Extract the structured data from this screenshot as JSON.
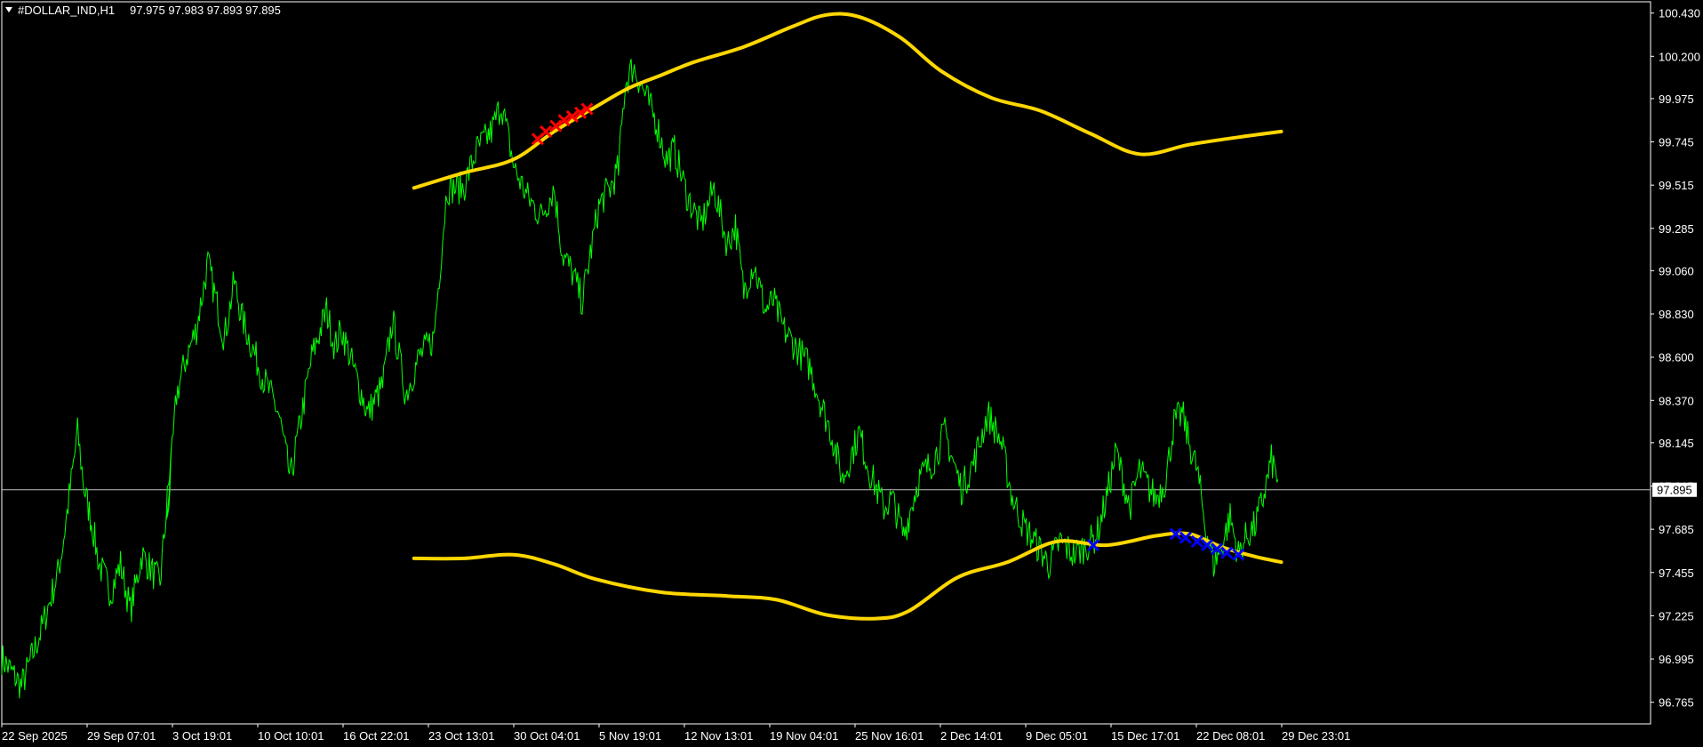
{
  "header": {
    "symbol": "#DOLLAR_IND,H1",
    "ohlc": "97.975 97.983 97.893 97.895"
  },
  "colors": {
    "background": "#000000",
    "frame": "#ffffff",
    "price": "#00ff00",
    "band": "#ffd700",
    "sell_marker": "#ff0000",
    "buy_marker": "#0000ff",
    "bid_line": "#c0c0c0"
  },
  "chart_data": {
    "type": "line",
    "title": "",
    "xlabel": "",
    "ylabel": "",
    "ylim": [
      96.65,
      100.49
    ],
    "yticks": [
      "100.430",
      "100.200",
      "99.975",
      "99.745",
      "99.515",
      "99.285",
      "99.060",
      "98.830",
      "98.600",
      "98.370",
      "98.145",
      "97.915",
      "97.685",
      "97.455",
      "97.225",
      "96.995",
      "96.765"
    ],
    "xticks": [
      "22 Sep 2025",
      "29 Sep 07:01",
      "3 Oct 19:01",
      "10 Oct 10:01",
      "16 Oct 22:01",
      "23 Oct 13:01",
      "30 Oct 04:01",
      "5 Nov 19:01",
      "12 Nov 13:01",
      "19 Nov 04:01",
      "25 Nov 16:01",
      "2 Dec 14:01",
      "9 Dec 05:01",
      "15 Dec 17:01",
      "22 Dec 08:01",
      "29 Dec 23:01"
    ],
    "current_price": "97.895",
    "series": [
      {
        "role": "price",
        "x": [
          0,
          0.012,
          0.024,
          0.034,
          0.037,
          0.046,
          0.05,
          0.055,
          0.059,
          0.066,
          0.072,
          0.078,
          0.085,
          0.092,
          0.096,
          0.103,
          0.1,
          0.106,
          0.112,
          0.118,
          0.125,
          0.13,
          0.135,
          0.141,
          0.146,
          0.158,
          0.168,
          0.175,
          0.182,
          0.188,
          0.197,
          0.202,
          0.206,
          0.213,
          0.222,
          0.231,
          0.237,
          0.245,
          0.253,
          0.262,
          0.27,
          0.28,
          0.288,
          0.297,
          0.303,
          0.311,
          0.319,
          0.327,
          0.335,
          0.34,
          0.346,
          0.352,
          0.357,
          0.362,
          0.365,
          0.369,
          0.374,
          0.378,
          0.383,
          0.39,
          0.397,
          0.403,
          0.408,
          0.416,
          0.424,
          0.432,
          0.44,
          0.445,
          0.45,
          0.456,
          0.463,
          0.468,
          0.474,
          0.482,
          0.49,
          0.497,
          0.503,
          0.51,
          0.52,
          0.526,
          0.535,
          0.54,
          0.547,
          0.556,
          0.565,
          0.572,
          0.582,
          0.59,
          0.598,
          0.606,
          0.613,
          0.62,
          0.628,
          0.635,
          0.642,
          0.65,
          0.658,
          0.664,
          0.67,
          0.676,
          0.68,
          0.684,
          0.69,
          0.696,
          0.7,
          0.706,
          0.711,
          0.716,
          0.72,
          0.725,
          0.73,
          0.735,
          0.74,
          0.745,
          0.75,
          0.755,
          0.76,
          0.765,
          0.77,
          0.774
        ],
        "y": [
          97.0,
          96.85,
          97.15,
          97.45,
          97.6,
          98.2,
          97.9,
          97.7,
          97.5,
          97.35,
          97.5,
          97.25,
          97.55,
          97.45,
          97.4,
          98.1,
          97.7,
          98.4,
          98.6,
          98.75,
          99.1,
          98.9,
          98.7,
          99.0,
          98.8,
          98.5,
          98.3,
          97.95,
          98.3,
          98.6,
          98.85,
          98.65,
          98.75,
          98.55,
          98.3,
          98.45,
          98.8,
          98.4,
          98.6,
          98.7,
          99.5,
          99.5,
          99.7,
          99.8,
          99.95,
          99.6,
          99.45,
          99.35,
          99.5,
          99.15,
          99.05,
          98.9,
          99.15,
          99.4,
          99.45,
          99.5,
          99.6,
          100.05,
          100.15,
          100.0,
          99.85,
          99.65,
          99.7,
          99.45,
          99.3,
          99.5,
          99.2,
          99.3,
          98.95,
          99.1,
          98.85,
          98.9,
          98.75,
          98.65,
          98.55,
          98.35,
          98.2,
          97.95,
          98.2,
          98.0,
          97.8,
          97.85,
          97.65,
          97.95,
          98.05,
          98.2,
          97.9,
          98.05,
          98.3,
          98.15,
          97.85,
          97.7,
          97.6,
          97.5,
          97.62,
          97.55,
          97.6,
          97.65,
          97.85,
          98.1,
          97.95,
          97.8,
          98.0,
          97.9,
          97.85,
          97.95,
          98.25,
          98.3,
          98.15,
          98.0,
          97.7,
          97.5,
          97.6,
          97.75,
          97.55,
          97.65,
          97.7,
          97.85,
          98.05,
          97.95
        ]
      },
      {
        "role": "upper-band",
        "x": [
          0.25,
          0.28,
          0.31,
          0.335,
          0.36,
          0.38,
          0.4,
          0.42,
          0.45,
          0.48,
          0.5,
          0.52,
          0.545,
          0.57,
          0.6,
          0.63,
          0.66,
          0.69,
          0.72,
          0.75,
          0.776
        ],
        "y": [
          99.5,
          99.58,
          99.65,
          99.8,
          99.93,
          100.03,
          100.1,
          100.17,
          100.25,
          100.36,
          100.42,
          100.41,
          100.3,
          100.12,
          99.98,
          99.91,
          99.79,
          99.68,
          99.73,
          99.77,
          99.8
        ]
      },
      {
        "role": "lower-band",
        "x": [
          0.25,
          0.28,
          0.31,
          0.335,
          0.36,
          0.4,
          0.44,
          0.47,
          0.5,
          0.53,
          0.55,
          0.58,
          0.61,
          0.64,
          0.67,
          0.7,
          0.72,
          0.74,
          0.76,
          0.776
        ],
        "y": [
          97.53,
          97.53,
          97.55,
          97.5,
          97.42,
          97.35,
          97.33,
          97.31,
          97.23,
          97.21,
          97.25,
          97.43,
          97.51,
          97.62,
          97.6,
          97.65,
          97.66,
          97.59,
          97.54,
          97.51
        ]
      }
    ],
    "markers": [
      {
        "type": "sell",
        "x": [
          0.325,
          0.33,
          0.336,
          0.341,
          0.346,
          0.351,
          0.355
        ],
        "y": [
          99.76,
          99.8,
          99.83,
          99.86,
          99.88,
          99.9,
          99.92
        ]
      },
      {
        "type": "buy",
        "x": [
          0.662
        ],
        "y": [
          97.6
        ]
      },
      {
        "type": "buy",
        "x": [
          0.712,
          0.718,
          0.725,
          0.731,
          0.737,
          0.743,
          0.75
        ],
        "y": [
          97.66,
          97.64,
          97.62,
          97.6,
          97.58,
          97.56,
          97.55
        ]
      }
    ]
  }
}
